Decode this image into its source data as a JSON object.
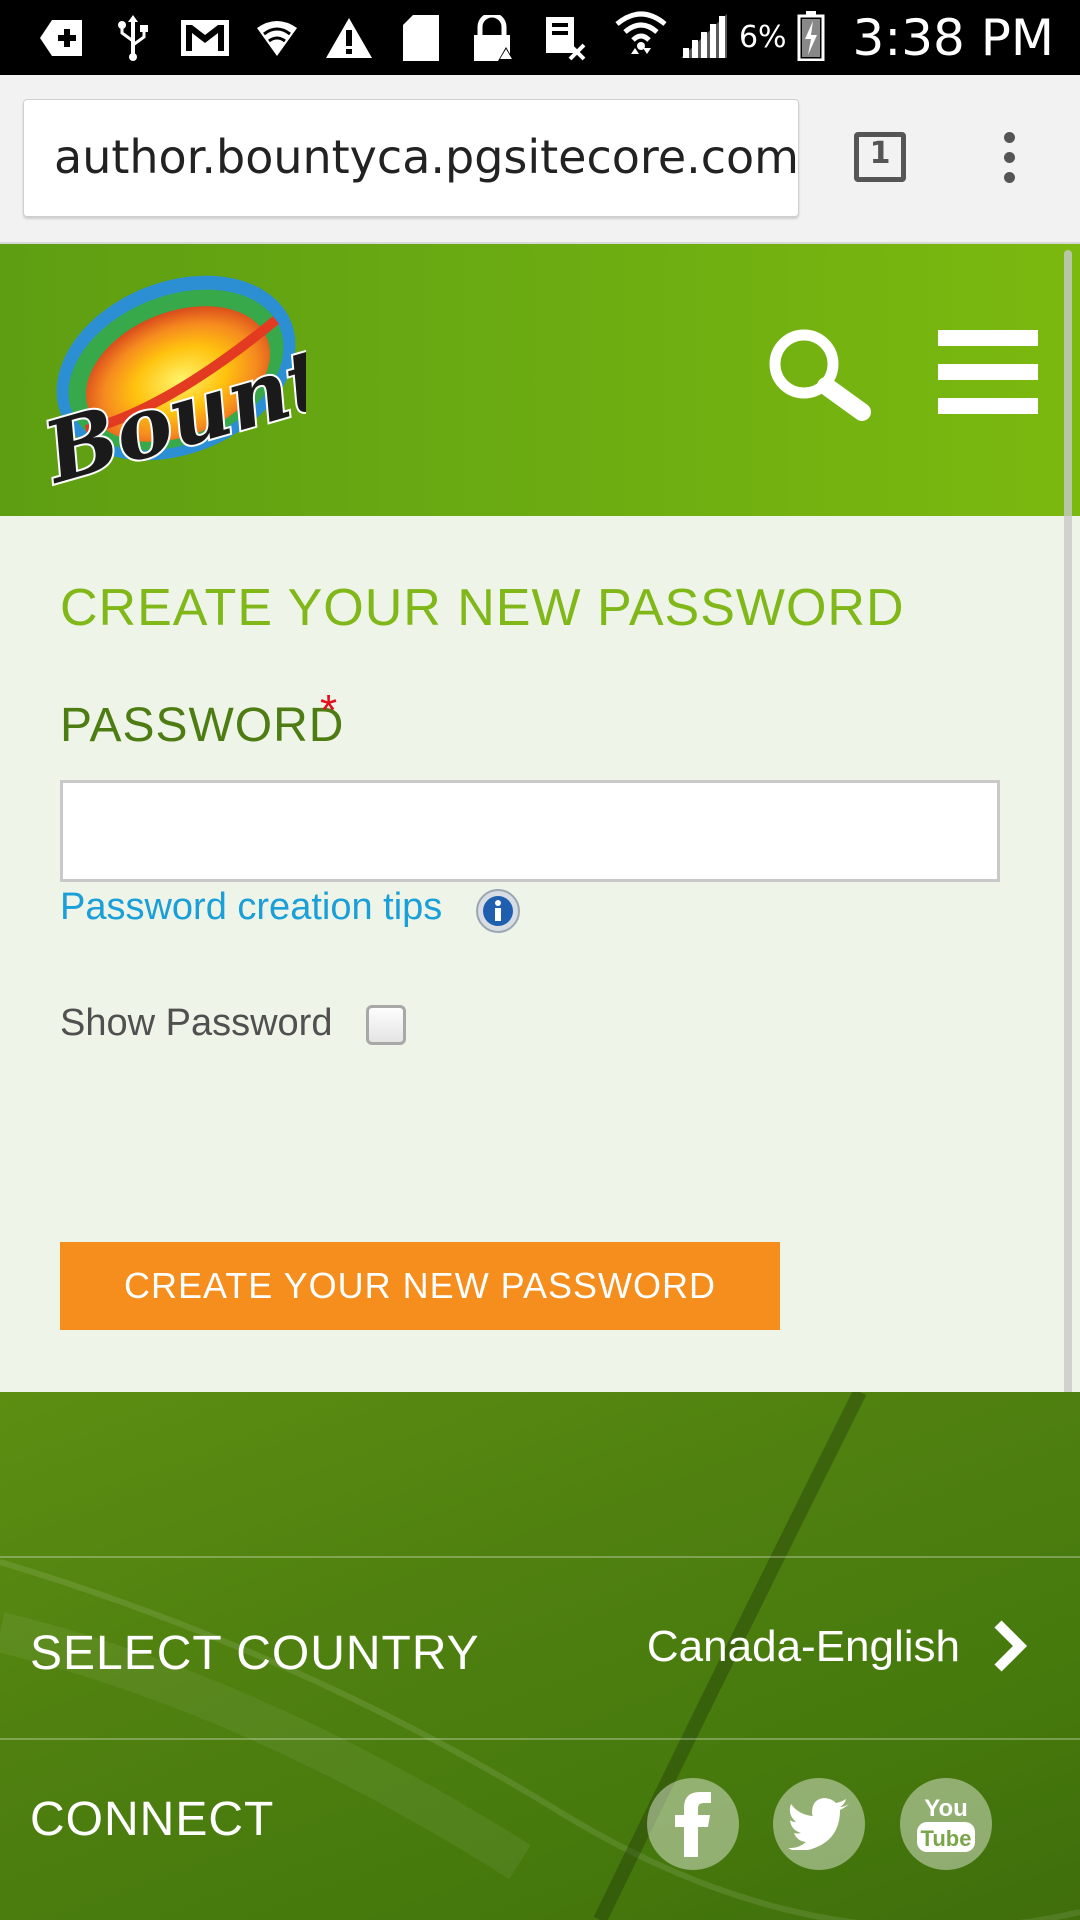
{
  "status_bar": {
    "battery_percent": "6%",
    "time": "3:38 PM",
    "icons": [
      "add-icon",
      "usb-icon",
      "gmail-icon",
      "wifi-icon",
      "warning-icon",
      "sim-icon",
      "lock-icon",
      "data-icon",
      "wifi-signal-icon",
      "cell-signal-icon",
      "battery-icon"
    ]
  },
  "browser": {
    "url": "author.bountyca.pgsitecore.com",
    "tab_count": "1"
  },
  "header": {
    "logo_text": "Bounty",
    "brand_color": "#6aaa12"
  },
  "form": {
    "title": "CREATE YOUR NEW PASSWORD",
    "password_label": "PASSWORD",
    "required_mark": "*",
    "password_value": "",
    "tips_link": "Password creation tips",
    "show_password_label": "Show Password",
    "show_password_checked": false,
    "submit_label": "CREATE YOUR NEW PASSWORD",
    "accent_color": "#f68e1e"
  },
  "footer": {
    "select_country_label": "SELECT COUNTRY",
    "country_value": "Canada-English",
    "connect_label": "CONNECT",
    "social": [
      "facebook-icon",
      "twitter-icon",
      "youtube-icon"
    ],
    "youtube_top": "You",
    "youtube_bottom": "Tube"
  }
}
